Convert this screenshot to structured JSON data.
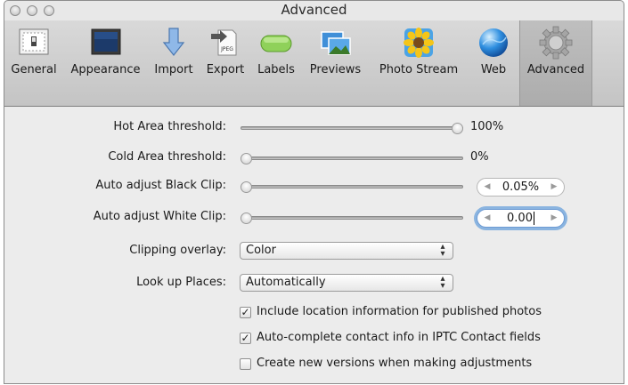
{
  "window": {
    "title": "Advanced"
  },
  "toolbar": {
    "items": [
      {
        "label": "General",
        "icon": "general-switch-icon"
      },
      {
        "label": "Appearance",
        "icon": "monitor-icon"
      },
      {
        "label": "Import",
        "icon": "import-arrow-icon"
      },
      {
        "label": "Export",
        "icon": "export-jpeg-icon"
      },
      {
        "label": "Labels",
        "icon": "label-tag-icon"
      },
      {
        "label": "Previews",
        "icon": "previews-icon"
      },
      {
        "label": "Photo Stream",
        "icon": "photo-stream-sunflower-icon"
      },
      {
        "label": "Web",
        "icon": "web-globe-icon"
      },
      {
        "label": "Advanced",
        "icon": "gear-icon",
        "selected": true
      }
    ]
  },
  "settings": {
    "hot_area": {
      "label": "Hot Area threshold:",
      "value": "100%",
      "level": 1.0
    },
    "cold_area": {
      "label": "Cold Area threshold:",
      "value": "0%",
      "level": 0.0
    },
    "black_clip": {
      "label": "Auto adjust Black Clip:",
      "value": "0.05%",
      "level": 0.0
    },
    "white_clip": {
      "label": "Auto adjust White Clip:",
      "value": "0.00",
      "level": 0.0
    },
    "clipping_overlay": {
      "label": "Clipping overlay:",
      "selected": "Color"
    },
    "look_up_places": {
      "label": "Look up Places:",
      "selected": "Automatically"
    },
    "include_location": {
      "label": "Include location information for published photos",
      "checked": true
    },
    "auto_complete": {
      "label": "Auto-complete contact info in IPTC Contact fields",
      "checked": true
    },
    "create_versions": {
      "label": "Create new versions when making adjustments",
      "checked": false
    }
  },
  "colors": {
    "focus_ring": "#8ab4e0",
    "toolbar_bg": "#c4c4c4",
    "panel_bg": "#ececec"
  }
}
